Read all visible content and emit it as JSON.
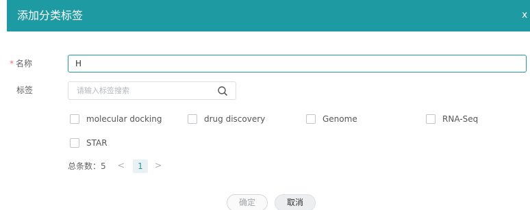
{
  "dialog": {
    "title": "添加分类标签",
    "close_glyph": "x"
  },
  "form": {
    "name": {
      "required_mark": "*",
      "label": "名称",
      "value": "H"
    },
    "tags": {
      "label": "标签",
      "search_placeholder": "请输入标签搜索",
      "options": [
        {
          "label": "molecular docking",
          "checked": false
        },
        {
          "label": "drug discovery",
          "checked": false
        },
        {
          "label": "Genome",
          "checked": false
        },
        {
          "label": "RNA-Seq",
          "checked": false
        },
        {
          "label": "STAR",
          "checked": false
        }
      ]
    }
  },
  "pagination": {
    "total_text": "总条数：5",
    "prev_glyph": "<",
    "current_page": "1",
    "next_glyph": ">"
  },
  "actions": {
    "confirm_label": "确定",
    "cancel_label": "取消"
  },
  "colors": {
    "accent": "#1e9aa3",
    "required": "#f56c6c"
  },
  "icons": {
    "search": "search-icon",
    "close": "close-icon"
  }
}
